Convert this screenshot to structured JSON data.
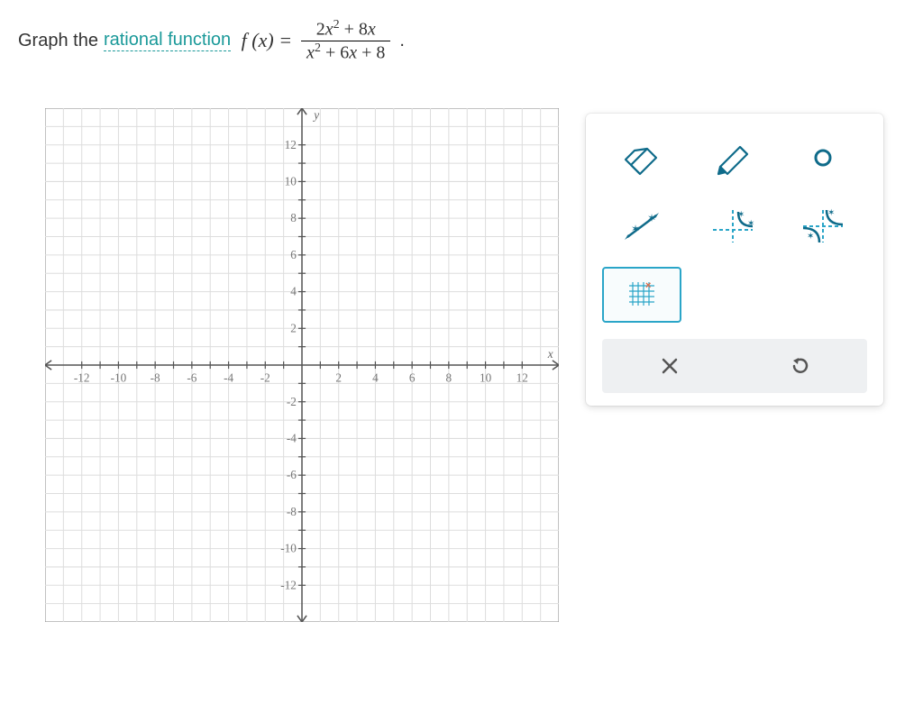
{
  "question": {
    "prefix": "Graph the ",
    "link": "rational function",
    "fn_left": "f (x) = ",
    "numerator_html": "2x² + 8x",
    "denominator_html": "x² + 6x + 8",
    "suffix": "."
  },
  "chart_data": {
    "type": "scatter",
    "title": "",
    "xlabel": "x",
    "ylabel": "y",
    "xlim": [
      -14,
      14
    ],
    "ylim": [
      -14,
      14
    ],
    "xticks": [
      -12,
      -10,
      -8,
      -6,
      -4,
      -2,
      2,
      4,
      6,
      8,
      10,
      12
    ],
    "yticks": [
      -12,
      -10,
      -8,
      -6,
      -4,
      -2,
      2,
      4,
      6,
      8,
      10,
      12
    ],
    "grid": true,
    "series": []
  },
  "tools": {
    "eraser": "eraser",
    "pencil": "pencil",
    "hole": "hole-point",
    "line": "line",
    "asymptote_pair": "asymptote-pair",
    "hyperbola": "hyperbola",
    "removable": "removable-discontinuity",
    "cancel_label": "Cancel",
    "reset_label": "Reset"
  }
}
